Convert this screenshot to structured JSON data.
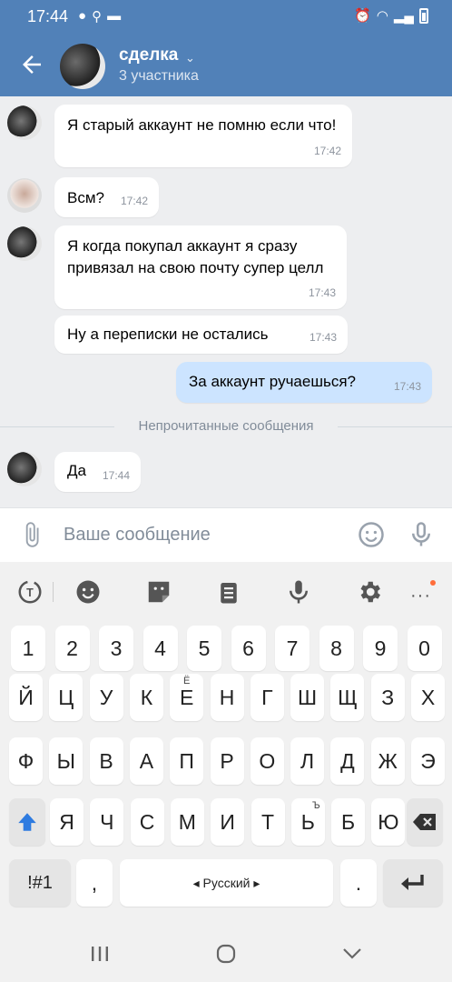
{
  "status": {
    "time": "17:44"
  },
  "header": {
    "title": "сделка",
    "subtitle": "3 участника"
  },
  "messages": [
    {
      "text": "Я старый аккаунт не помню если что!",
      "time": "17:42"
    },
    {
      "text": "Всм?",
      "time": "17:42"
    },
    {
      "text": "Я когда покупал аккаунт я сразу привязал на свою почту супер целл",
      "time": "17:43"
    },
    {
      "text": "Ну а переписки не остались",
      "time": "17:43"
    },
    {
      "text": "За аккаунт ручаешься?",
      "time": "17:43"
    },
    {
      "text": "Да",
      "time": "17:44"
    }
  ],
  "unread_label": "Непрочитанные сообщения",
  "composer": {
    "placeholder": "Ваше сообщение"
  },
  "keyboard": {
    "digits": [
      "1",
      "2",
      "3",
      "4",
      "5",
      "6",
      "7",
      "8",
      "9",
      "0"
    ],
    "row1": [
      "Й",
      "Ц",
      "У",
      "К",
      "Е",
      "Н",
      "Г",
      "Ш",
      "Щ",
      "З",
      "Х"
    ],
    "row1_sub": "Ё",
    "row2": [
      "Ф",
      "Ы",
      "В",
      "А",
      "П",
      "Р",
      "О",
      "Л",
      "Д",
      "Ж",
      "Э"
    ],
    "row3": [
      "Я",
      "Ч",
      "С",
      "М",
      "И",
      "Т",
      "Ь",
      "Б",
      "Ю"
    ],
    "row3_sub": "Ъ",
    "symbols": "!#1",
    "comma": ",",
    "space": "◂ Русский ▸",
    "period": "."
  },
  "colors": {
    "header": "#5181b8",
    "outgoing": "#cce4ff",
    "accent_dot": "#ff6d3a"
  }
}
